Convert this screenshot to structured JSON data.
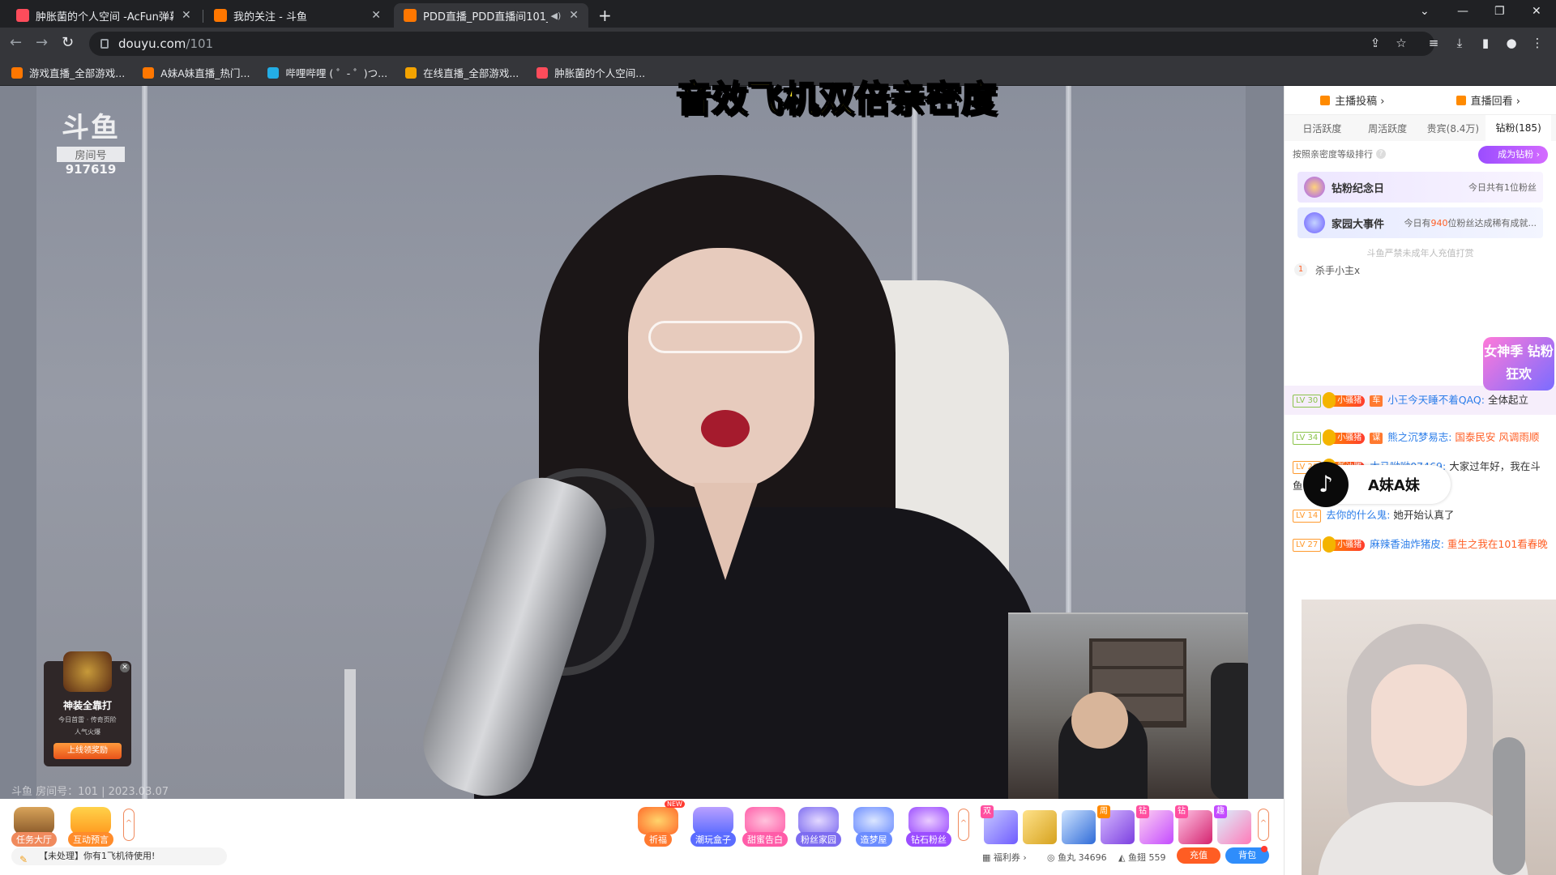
{
  "tabs": [
    {
      "title": "肿胀菌的个人空间 -AcFun弹幕视",
      "color": "#fd4c5b"
    },
    {
      "title": "我的关注 - 斗鱼",
      "color": "#ff7700"
    },
    {
      "title": "PDD直播_PDD直播间101_英",
      "color": "#ff7700"
    }
  ],
  "address": {
    "host": "douyu.com",
    "path": "/101"
  },
  "bookmarks": [
    {
      "label": "游戏直播_全部游戏...",
      "color": "#ff7700"
    },
    {
      "label": "A妹A妹直播_热门...",
      "color": "#ff7700"
    },
    {
      "label": "哔哩哔哩 ( ゜- ゜)つ...",
      "color": "#23ade5"
    },
    {
      "label": "在线直播_全部游戏...",
      "color": "#f3a300"
    },
    {
      "label": "肿胀菌的个人空间...",
      "color": "#fd4c5b"
    }
  ],
  "overlay": {
    "headline": "音效飞机双倍亲密度",
    "room_mark": "斗鱼",
    "room_tag": "房间号",
    "room_no": "917619",
    "watermark": "斗鱼 房间号：101 | 2023.03.07"
  },
  "promo": {
    "title": "神装全靠打",
    "sub1": "今日首雷 · 传奇页阶",
    "sub2": "人气火爆",
    "button": "上线领奖励"
  },
  "giftbar": {
    "left": [
      {
        "label": "任务大厅",
        "color": "#f08a5d"
      },
      {
        "label": "互动预言",
        "color": "#ff8c2b"
      }
    ],
    "right": [
      {
        "label": "祈福",
        "color": "#ff7a30"
      },
      {
        "label": "潮玩盒子",
        "color": "#5b6cff"
      },
      {
        "label": "甜蜜告白",
        "color": "#ff5ca8"
      },
      {
        "label": "粉丝家园",
        "color": "#7d6cf0"
      },
      {
        "label": "造梦屋",
        "color": "#6b8cff"
      },
      {
        "label": "钻石粉丝",
        "color": "#9b4dff"
      }
    ],
    "new_badge": "NEW",
    "notice": "【未处理】你有1飞机待使用!",
    "welfare": "福利券",
    "fishball": "鱼丸 34696",
    "fishfin": "鱼翅 559",
    "recharge": "充值",
    "bag": "背包"
  },
  "side": {
    "top_left": "主播投稿",
    "top_right": "直播回看",
    "rank_tabs": [
      "日活跃度",
      "周活跃度",
      "贵宾(8.4万)",
      "钻粉(185)"
    ],
    "rank_note": "按照亲密度等级排行",
    "diamond_btn": "成为钻粉",
    "banner1_title": "钻粉纪念日",
    "banner1_sub": "今日共有1位粉丝",
    "banner2_title": "家园大事件",
    "banner2_sub_a": "今日有",
    "banner2_sub_b": "940",
    "banner2_sub_c": "位粉丝达成稀有成就...",
    "safety": "斗鱼严禁未成年人充值打赏",
    "rank1_no": "1",
    "rank1_name": "杀手小主x",
    "goddess": "女神季 钻粉狂欢"
  },
  "chat": [
    {
      "lv": "LV 30",
      "fan": "小骚猪",
      "nobel": "车",
      "name": "小王今天睡不着QAQ:",
      "text": "全体起立",
      "hl": true
    },
    {
      "lv": "LV 34",
      "fan": "小骚猪",
      "nobel": "谋",
      "name": "熊之沉梦易志:",
      "text": "国泰民安 风调雨顺"
    },
    {
      "lv": "LV 28",
      "fan": "新沙雕",
      "name": "木马呦呦07469:",
      "text": "大家过年好，我在斗鱼101看春晚"
    },
    {
      "lv": "LV 14",
      "name": "去你的什么鬼:",
      "text": "她开始认真了"
    },
    {
      "lv": "LV 27",
      "fan": "小骚猪",
      "name": "麻辣香油炸猪皮:",
      "text": "重生之我在101看春晚"
    }
  ],
  "tiktok": {
    "name": "A妹A妹"
  }
}
